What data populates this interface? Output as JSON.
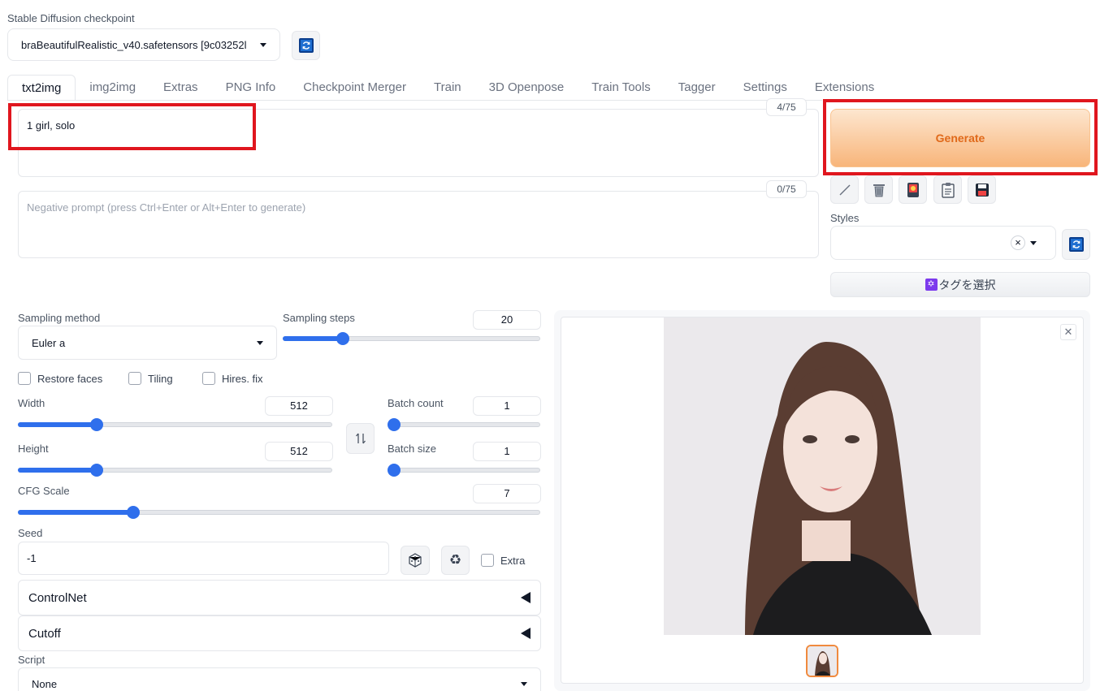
{
  "checkpoint": {
    "label": "Stable Diffusion checkpoint",
    "value": "braBeautifulRealistic_v40.safetensors [9c03252l"
  },
  "tabs": [
    "txt2img",
    "img2img",
    "Extras",
    "PNG Info",
    "Checkpoint Merger",
    "Train",
    "3D Openpose",
    "Train Tools",
    "Tagger",
    "Settings",
    "Extensions"
  ],
  "prompt": {
    "value": "1 girl, solo",
    "counter": "4/75"
  },
  "negative_prompt": {
    "placeholder": "Negative prompt (press Ctrl+Enter or Alt+Enter to generate)",
    "counter": "0/75"
  },
  "generate_label": "Generate",
  "styles": {
    "label": "Styles",
    "clear_symbol": "×"
  },
  "tag_select_label": "タグを選択",
  "sampling": {
    "method_label": "Sampling method",
    "method_value": "Euler a",
    "steps_label": "Sampling steps",
    "steps_value": "20",
    "steps_level": 0.22
  },
  "options": {
    "restore_faces": "Restore faces",
    "tiling": "Tiling",
    "hires_fix": "Hires. fix"
  },
  "width": {
    "label": "Width",
    "value": "512",
    "level": 0.24
  },
  "height": {
    "label": "Height",
    "value": "512",
    "level": 0.24
  },
  "batch_count": {
    "label": "Batch count",
    "value": "1",
    "level": 0.0
  },
  "batch_size": {
    "label": "Batch size",
    "value": "1",
    "level": 0.0
  },
  "cfg_scale": {
    "label": "CFG Scale",
    "value": "7",
    "level": 0.214
  },
  "seed": {
    "label": "Seed",
    "value": "-1",
    "extra_label": "Extra"
  },
  "accordions": [
    "ControlNet",
    "Cutoff"
  ],
  "script": {
    "label": "Script",
    "value": "None"
  },
  "icons": {
    "swap": "swap-dimensions-icon",
    "dice": "dice-icon",
    "recycle": "recycle-icon"
  },
  "colors": {
    "generate_gradient_start": "#fde6cf",
    "generate_gradient_end": "#f8b57a",
    "generate_text": "#e0691a",
    "slider": "#2f6fec",
    "highlight": "#e0161e"
  }
}
